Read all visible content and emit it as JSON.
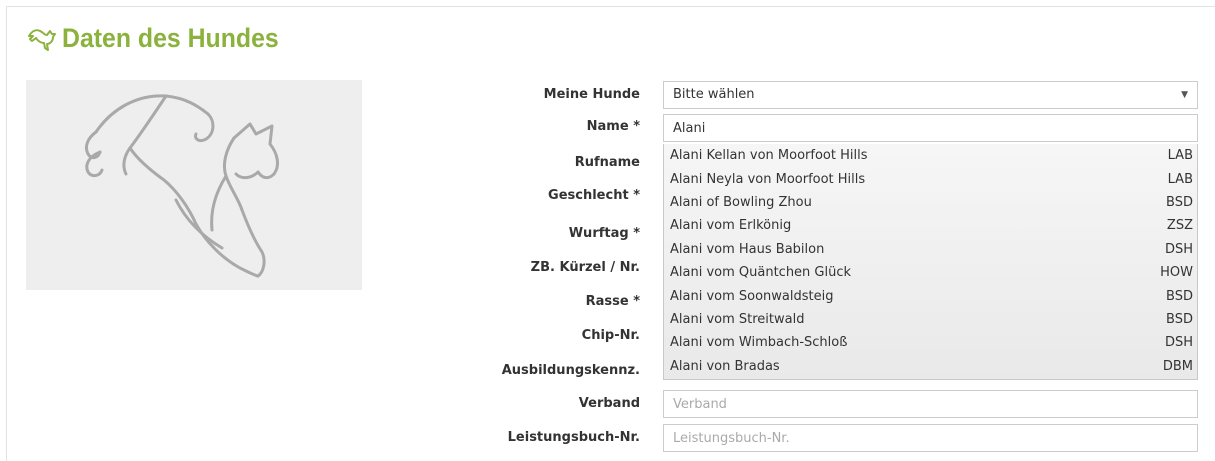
{
  "section": {
    "title": "Daten des Hundes",
    "accent_color": "#8ab23c",
    "icon": "dog-jump-icon"
  },
  "form": {
    "labels": {
      "meine_hunde": "Meine Hunde",
      "name": "Name *",
      "rufname": "Rufname",
      "geschlecht": "Geschlecht *",
      "wurftag": "Wurftag *",
      "zb_kuerzel": "ZB. Kürzel / Nr.",
      "rasse": "Rasse *",
      "chip_nr": "Chip-Nr.",
      "ausbildungskennz": "Ausbildungskennz.",
      "verband": "Verband",
      "leistungsbuch_nr": "Leistungsbuch-Nr."
    },
    "meine_hunde_selected": "Bitte wählen",
    "name_value": "Alani",
    "verband_placeholder": "Verband",
    "leistungsbuch_placeholder": "Leistungsbuch-Nr."
  },
  "autocomplete": {
    "items": [
      {
        "name": "Alani Kellan von Moorfoot Hills",
        "code": "LAB"
      },
      {
        "name": "Alani Neyla von Moorfoot Hills",
        "code": "LAB"
      },
      {
        "name": "Alani of Bowling Zhou",
        "code": "BSD"
      },
      {
        "name": "Alani vom Erlkönig",
        "code": "ZSZ"
      },
      {
        "name": "Alani vom Haus Babilon",
        "code": "DSH"
      },
      {
        "name": "Alani vom Quäntchen Glück",
        "code": "HOW"
      },
      {
        "name": "Alani vom Soonwaldsteig",
        "code": "BSD"
      },
      {
        "name": "Alani vom Streitwald",
        "code": "BSD"
      },
      {
        "name": "Alani vom Wimbach-Schloß",
        "code": "DSH"
      },
      {
        "name": "Alani von Bradas",
        "code": "DBM"
      }
    ]
  }
}
